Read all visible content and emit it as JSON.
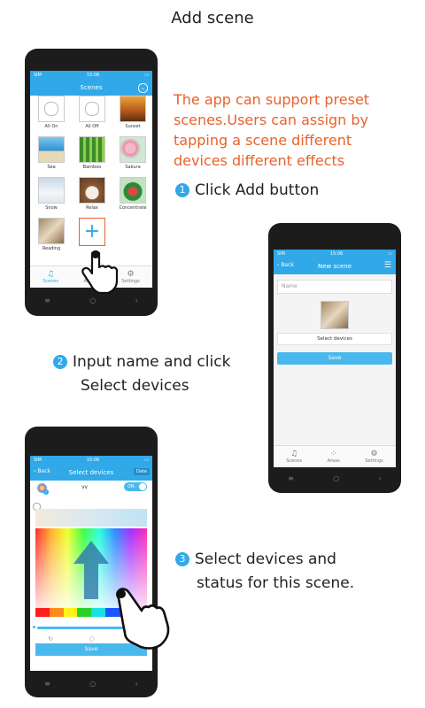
{
  "title": "Add scene",
  "description_lines": [
    "The app can support preset",
    "scenes.Users can assign by",
    "tapping a scene different",
    "devices different effects"
  ],
  "steps": {
    "s1": {
      "num": "1",
      "text": "Click Add button"
    },
    "s2": {
      "num": "2",
      "line1": "Input name and click",
      "line2": "Select devices"
    },
    "s3": {
      "num": "3",
      "line1": "Select devices and",
      "line2": "status for this scene."
    }
  },
  "phone1": {
    "status_left": "SIM",
    "status_time": "15:06",
    "header": "Scenes",
    "scenes": [
      "All On",
      "All Off",
      "Sunset",
      "Sea",
      "Bamboo",
      "Sakura",
      "Snow",
      "Relax",
      "Concentrate",
      "Reading"
    ],
    "tabs": [
      "Scenes",
      "Areas",
      "Settings"
    ]
  },
  "phone2": {
    "status_left": "SIM",
    "status_time": "15:06",
    "back": "Back",
    "header": "New scene",
    "name_placeholder": "Name",
    "select_devices": "Select devices",
    "save": "Save",
    "tabs": [
      "Scenes",
      "Areas",
      "Settings"
    ]
  },
  "phone3": {
    "status_left": "SIM",
    "status_time": "15:06",
    "back": "Back",
    "header": "Select devices",
    "done": "Date",
    "device_name": "vv",
    "toggle": "ON",
    "save": "Save"
  },
  "colors": {
    "accent": "#31a9e8",
    "highlight": "#e8622c"
  }
}
